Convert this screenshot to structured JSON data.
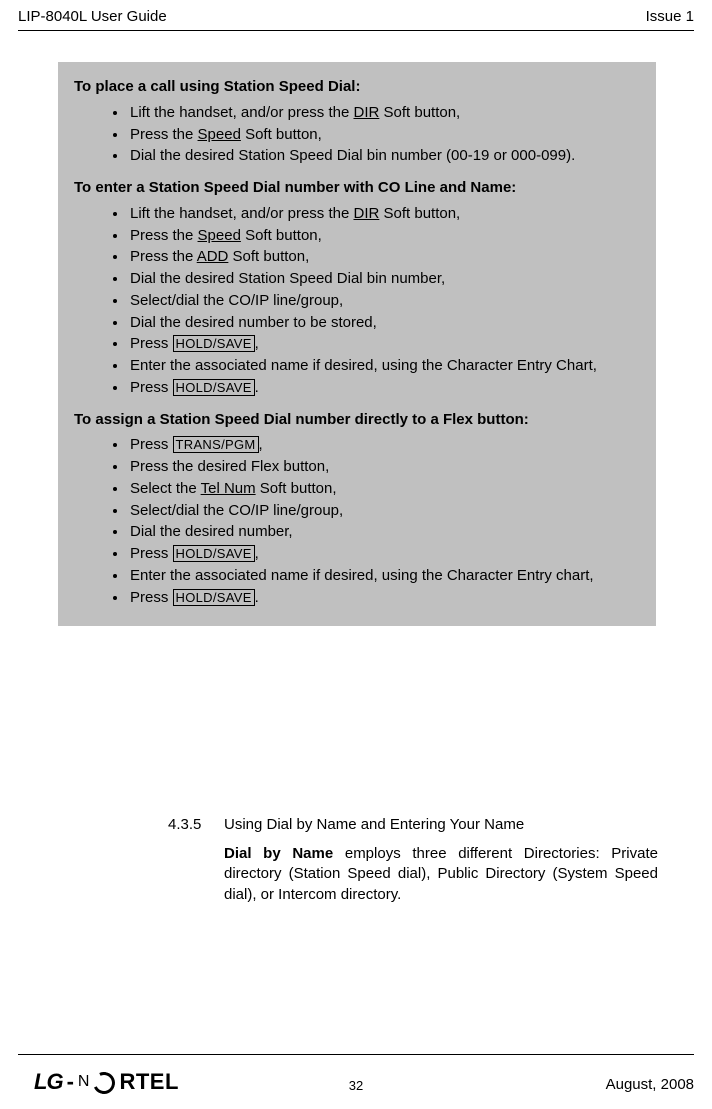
{
  "header": {
    "left": "LIP-8040L User Guide",
    "right": "Issue 1"
  },
  "box": {
    "h1": "To place a call using Station Speed Dial:",
    "list1": {
      "i0a": "Lift the handset, and/or press the ",
      "i0b_u": "DIR",
      "i0c": " Soft button,",
      "i1a": "Press the ",
      "i1b_u": "Speed",
      "i1c": " Soft button,",
      "i2": "Dial the desired Station Speed Dial bin number (00-19 or 000-099)."
    },
    "h2": "To enter a Station Speed Dial number with CO Line and Name:",
    "list2": {
      "i0a": "Lift the handset, and/or press the ",
      "i0b_u": "DIR",
      "i0c": " Soft button,",
      "i1a": "Press the ",
      "i1b_u": "Speed",
      "i1c": " Soft button,",
      "i2a": "Press the ",
      "i2b_u": "ADD",
      "i2c": " Soft button,",
      "i3": "Dial the desired Station Speed Dial bin number,",
      "i4": "Select/dial the CO/IP line/group,",
      "i5": "Dial the desired number to be stored,",
      "i6a": "Press ",
      "i6b_k": "HOLD/SAVE",
      "i6c": ",",
      "i7": "Enter the associated name if desired, using the Character Entry Chart,",
      "i8a": "Press ",
      "i8b_k": "HOLD/SAVE",
      "i8c": "."
    },
    "h3": "To assign a Station Speed Dial number directly to a Flex button:",
    "list3": {
      "i0a": "Press ",
      "i0b_k": "TRANS/PGM",
      "i0c": ",",
      "i1": "Press the desired Flex button,",
      "i2a": "Select the ",
      "i2b_u": "Tel Num",
      "i2c": " Soft button,",
      "i3": "Select/dial the CO/IP line/group,",
      "i4": "Dial the desired number,",
      "i5a": "Press ",
      "i5b_k": "HOLD/SAVE",
      "i5c": ",",
      "i6": "Enter the associated name if desired, using the Character Entry chart,",
      "i7a": "Press ",
      "i7b_k": "HOLD/SAVE",
      "i7c": "."
    }
  },
  "section": {
    "num": "4.3.5",
    "title": "Using Dial by Name and Entering Your Name",
    "para_bold": "Dial by Name",
    "para_rest": " employs three different Directories: Private directory (Station Speed dial), Public Directory (System Speed dial), or Intercom directory."
  },
  "logo": {
    "lg": "LG",
    "dash": "-",
    "rtel": "RTEL"
  },
  "footer": {
    "page": "32",
    "date": "August, 2008"
  }
}
